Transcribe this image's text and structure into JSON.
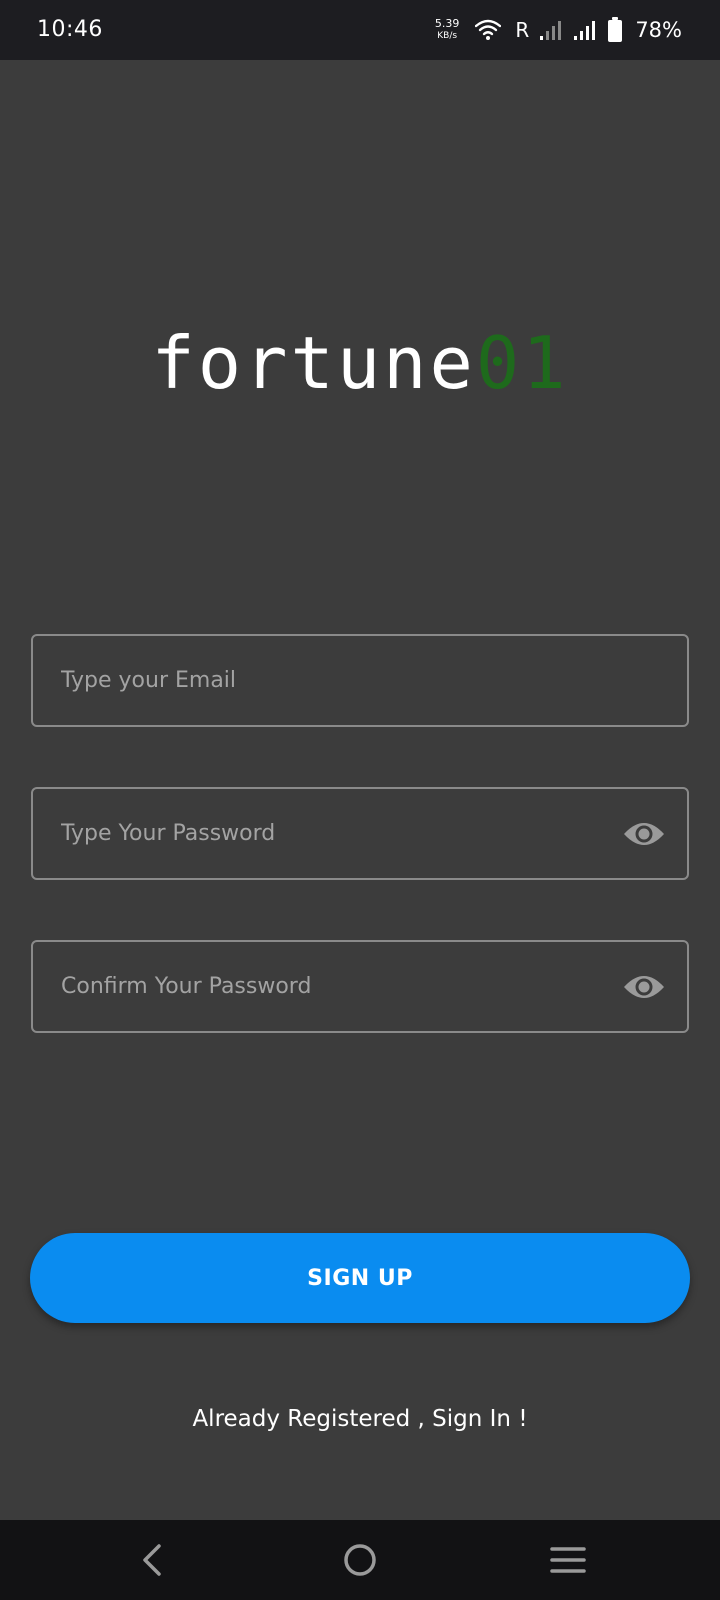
{
  "status_bar": {
    "time": "10:46",
    "net_speed_value": "5.39",
    "net_speed_unit": "KB/s",
    "roaming": "R",
    "battery": "78%"
  },
  "logo": {
    "main": "fortune",
    "accent": "01",
    "accent_color": "#1e6a1c"
  },
  "form": {
    "email_placeholder": "Type your Email",
    "password_placeholder": "Type Your Password",
    "confirm_placeholder": "Confirm Your Password",
    "email_value": "",
    "password_value": "",
    "confirm_value": ""
  },
  "signup_button": {
    "label": "SIGN UP",
    "color": "#0a8cf0"
  },
  "signin_link": "Already Registered , Sign In !",
  "nav": {
    "back_icon": "back-icon",
    "home_icon": "home-icon",
    "menu_icon": "recent-apps-icon"
  }
}
